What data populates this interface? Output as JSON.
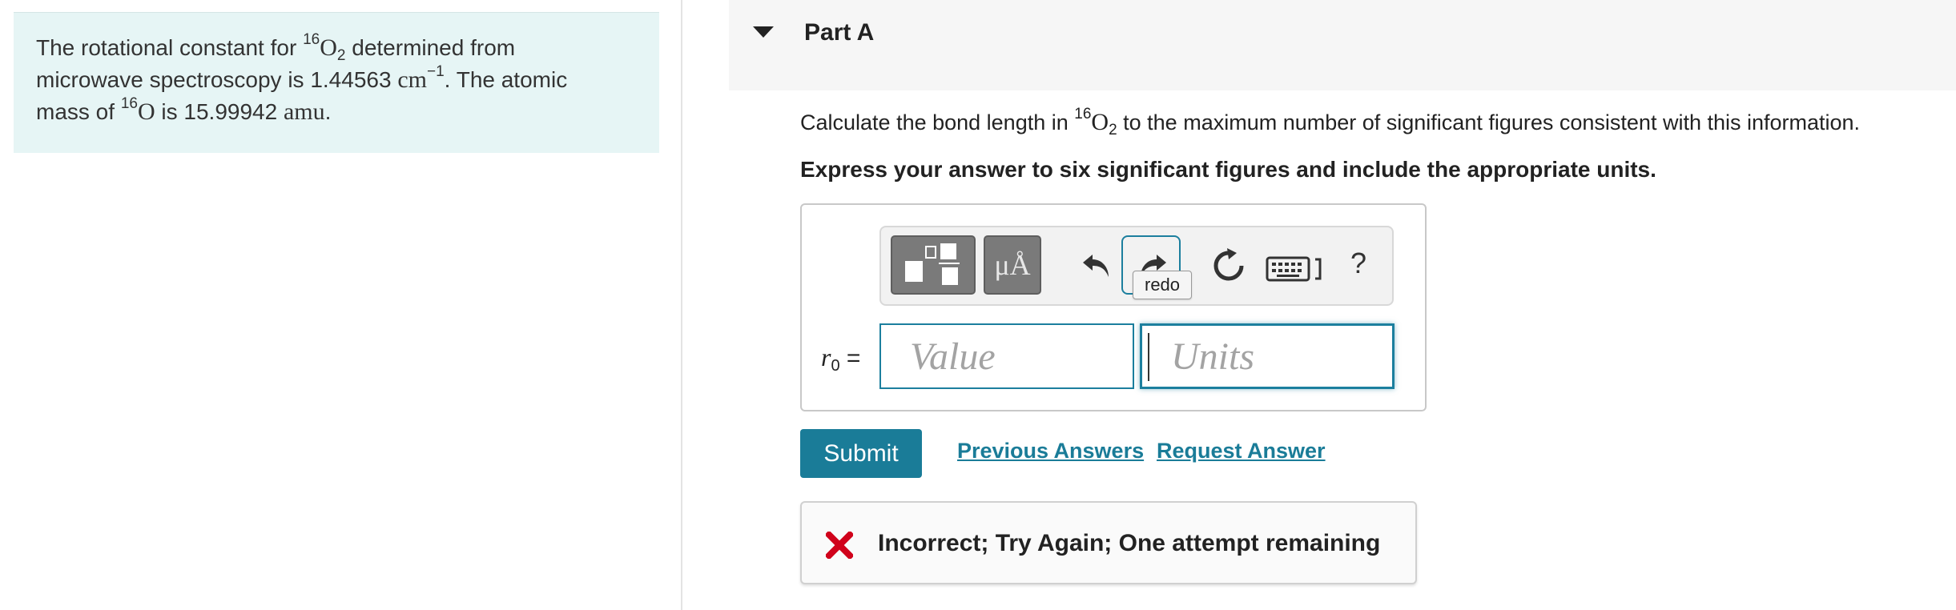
{
  "intro": {
    "line1_pre": "The rotational constant for ",
    "iso_mass": "16",
    "molecule_sym": "O",
    "molecule_sub": "2",
    "line1_post": " determined from",
    "line2_pre": "microwave spectroscopy is 1.44563 ",
    "wavenumber_unit": "cm",
    "wavenumber_exp": "−1",
    "line2_post": ". The atomic",
    "line3_pre": "mass of ",
    "atom_sym": "O",
    "line3_mid": " is 15.99942 ",
    "mass_unit": "amu",
    "line3_post": "."
  },
  "part": {
    "title": "Part A"
  },
  "question": {
    "pre": "Calculate the bond length in ",
    "iso_mass": "16",
    "molecule_sym": "O",
    "molecule_sub": "2",
    "post": " to the maximum number of significant figures consistent with this information."
  },
  "instruction": "Express your answer to six significant figures and include the appropriate units.",
  "toolbar": {
    "units_glyph": "μÅ",
    "redo_tooltip": "redo",
    "help": "?"
  },
  "answer": {
    "var_symbol": "r",
    "var_sub": "0",
    "equals": "=",
    "value_placeholder": "Value",
    "units_placeholder": "Units"
  },
  "actions": {
    "submit": "Submit",
    "previous_answers": "Previous Answers",
    "request_answer": "Request Answer"
  },
  "feedback": {
    "message": "Incorrect; Try Again; One attempt remaining",
    "icon": "x-icon",
    "color": "#d0021b"
  },
  "colors": {
    "accent": "#1a7c98",
    "intro_bg": "#e6f5f5"
  }
}
